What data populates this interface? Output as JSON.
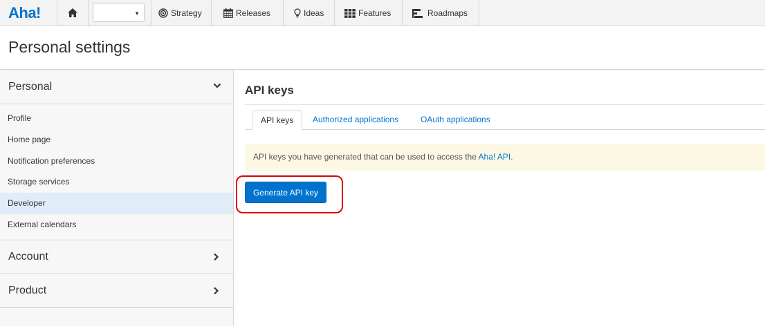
{
  "app": {
    "logo_text": "Aha!",
    "brand_color": "#0073cf"
  },
  "nav": {
    "home_icon": "home-icon",
    "workspace_select_value": "",
    "items": [
      {
        "label": "Strategy",
        "icon": "target-icon"
      },
      {
        "label": "Releases",
        "icon": "calendar-icon"
      },
      {
        "label": "Ideas",
        "icon": "lightbulb-icon"
      },
      {
        "label": "Features",
        "icon": "grid-icon"
      },
      {
        "label": "Roadmaps",
        "icon": "roadmap-icon"
      }
    ]
  },
  "header": {
    "title": "Personal settings"
  },
  "sidebar": {
    "sections": [
      {
        "label": "Personal",
        "expanded": true
      },
      {
        "label": "Account",
        "expanded": false
      },
      {
        "label": "Product",
        "expanded": false
      }
    ],
    "personal_items": [
      {
        "label": "Profile"
      },
      {
        "label": "Home page"
      },
      {
        "label": "Notification preferences"
      },
      {
        "label": "Storage services"
      },
      {
        "label": "Developer",
        "active": true
      },
      {
        "label": "External calendars"
      }
    ]
  },
  "main": {
    "title": "API keys",
    "tabs": [
      {
        "label": "API keys",
        "active": true
      },
      {
        "label": "Authorized applications"
      },
      {
        "label": "OAuth applications"
      }
    ],
    "notice_prefix": "API keys you have generated that can be used to access the ",
    "notice_link": "Aha! API",
    "notice_suffix": ".",
    "generate_button": "Generate API key",
    "notice_bg": "#fcf8e3",
    "highlight_color": "#dd0000"
  }
}
